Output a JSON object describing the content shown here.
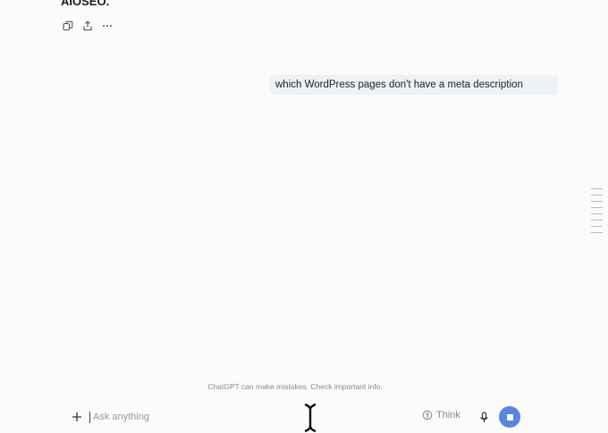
{
  "conversation": {
    "previous_text": "AIOSEO.",
    "user_message": "which WordPress pages don't have a meta description"
  },
  "message_actions": [
    {
      "icon": "copy-icon"
    },
    {
      "icon": "share-icon"
    },
    {
      "icon": "more-icon"
    }
  ],
  "footer": {
    "disclaimer": "ChatGPT can make mistakes. Check important info."
  },
  "composer": {
    "placeholder": "Ask anything",
    "think_label": "Think",
    "stop_color": "#5a86e0"
  }
}
